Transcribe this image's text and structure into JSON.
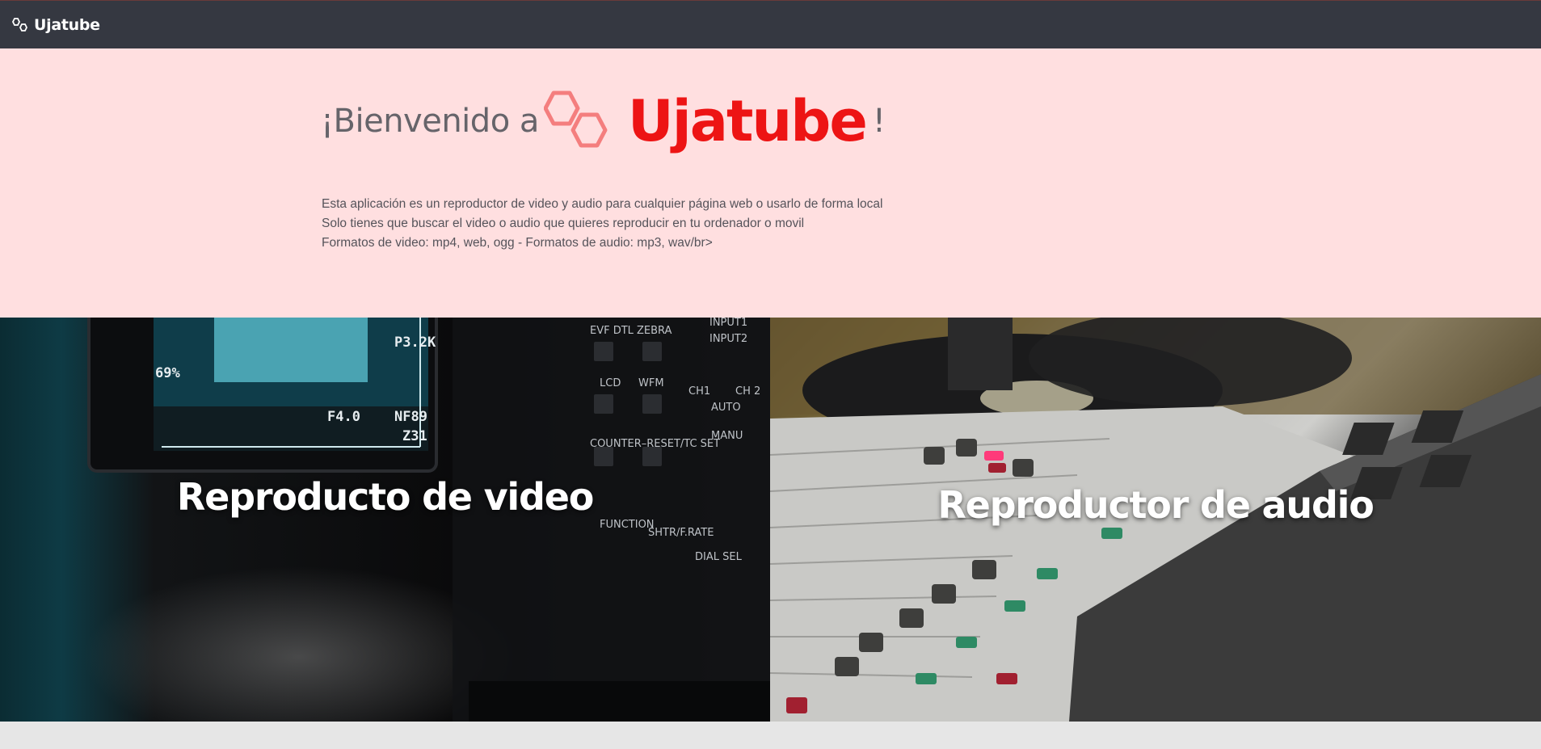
{
  "navbar": {
    "brand_name": "Ujatube",
    "brand_icon": "hexagons-logo-icon",
    "background": "#353841"
  },
  "hero": {
    "greeting": "¡Bienvenido a",
    "brand_name": "Ujatube",
    "exclamation": "!",
    "brand_color": "#ed1414",
    "icon_color": "#f47e7e",
    "background": "#ffdfe0",
    "description": [
      "Esta aplicación es un reproductor de video y audio para cualquier página web o usarlo de forma local",
      "Solo tienes que buscar el video o audio que quieres reproducir en tu ordenador o movil",
      "Formatos de video: mp4, web, ogg - Formatos de audio: mp3, wav/br>"
    ]
  },
  "panels": {
    "video": {
      "label": "Reproducto de video"
    },
    "audio": {
      "label": "Reproductor de audio"
    }
  }
}
